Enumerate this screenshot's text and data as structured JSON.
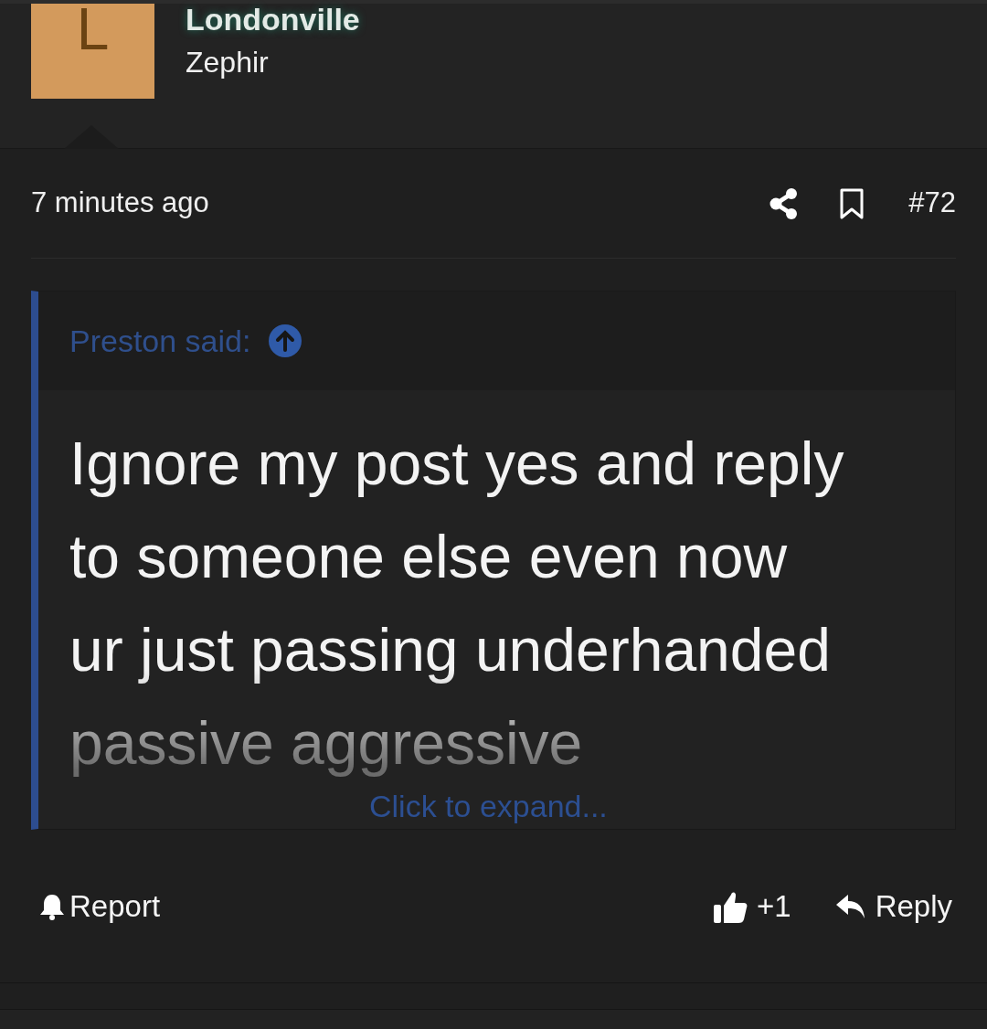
{
  "author": {
    "avatar_letter": "L",
    "name": "Londonville",
    "title": "Zephir"
  },
  "post": {
    "time": "7 minutes ago",
    "number": "#72"
  },
  "quote": {
    "attribution": "Preston said:",
    "text": "Ignore my post yes and reply to someone else even now ur just passing underhanded passive aggressive",
    "expand": "Click to expand..."
  },
  "actions": {
    "report": "Report",
    "like_count": "+1",
    "reply": "Reply"
  }
}
